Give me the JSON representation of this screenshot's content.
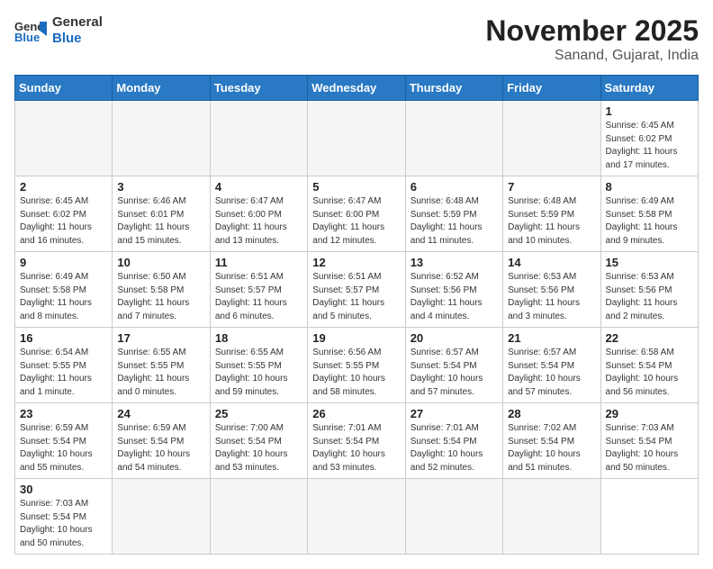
{
  "header": {
    "logo_general": "General",
    "logo_blue": "Blue",
    "month_year": "November 2025",
    "location": "Sanand, Gujarat, India"
  },
  "weekdays": [
    "Sunday",
    "Monday",
    "Tuesday",
    "Wednesday",
    "Thursday",
    "Friday",
    "Saturday"
  ],
  "days": [
    {
      "num": "",
      "info": ""
    },
    {
      "num": "",
      "info": ""
    },
    {
      "num": "",
      "info": ""
    },
    {
      "num": "",
      "info": ""
    },
    {
      "num": "",
      "info": ""
    },
    {
      "num": "",
      "info": ""
    },
    {
      "num": "1",
      "info": "Sunrise: 6:45 AM\nSunset: 6:02 PM\nDaylight: 11 hours\nand 17 minutes."
    },
    {
      "num": "2",
      "info": "Sunrise: 6:45 AM\nSunset: 6:02 PM\nDaylight: 11 hours\nand 16 minutes."
    },
    {
      "num": "3",
      "info": "Sunrise: 6:46 AM\nSunset: 6:01 PM\nDaylight: 11 hours\nand 15 minutes."
    },
    {
      "num": "4",
      "info": "Sunrise: 6:47 AM\nSunset: 6:00 PM\nDaylight: 11 hours\nand 13 minutes."
    },
    {
      "num": "5",
      "info": "Sunrise: 6:47 AM\nSunset: 6:00 PM\nDaylight: 11 hours\nand 12 minutes."
    },
    {
      "num": "6",
      "info": "Sunrise: 6:48 AM\nSunset: 5:59 PM\nDaylight: 11 hours\nand 11 minutes."
    },
    {
      "num": "7",
      "info": "Sunrise: 6:48 AM\nSunset: 5:59 PM\nDaylight: 11 hours\nand 10 minutes."
    },
    {
      "num": "8",
      "info": "Sunrise: 6:49 AM\nSunset: 5:58 PM\nDaylight: 11 hours\nand 9 minutes."
    },
    {
      "num": "9",
      "info": "Sunrise: 6:49 AM\nSunset: 5:58 PM\nDaylight: 11 hours\nand 8 minutes."
    },
    {
      "num": "10",
      "info": "Sunrise: 6:50 AM\nSunset: 5:58 PM\nDaylight: 11 hours\nand 7 minutes."
    },
    {
      "num": "11",
      "info": "Sunrise: 6:51 AM\nSunset: 5:57 PM\nDaylight: 11 hours\nand 6 minutes."
    },
    {
      "num": "12",
      "info": "Sunrise: 6:51 AM\nSunset: 5:57 PM\nDaylight: 11 hours\nand 5 minutes."
    },
    {
      "num": "13",
      "info": "Sunrise: 6:52 AM\nSunset: 5:56 PM\nDaylight: 11 hours\nand 4 minutes."
    },
    {
      "num": "14",
      "info": "Sunrise: 6:53 AM\nSunset: 5:56 PM\nDaylight: 11 hours\nand 3 minutes."
    },
    {
      "num": "15",
      "info": "Sunrise: 6:53 AM\nSunset: 5:56 PM\nDaylight: 11 hours\nand 2 minutes."
    },
    {
      "num": "16",
      "info": "Sunrise: 6:54 AM\nSunset: 5:55 PM\nDaylight: 11 hours\nand 1 minute."
    },
    {
      "num": "17",
      "info": "Sunrise: 6:55 AM\nSunset: 5:55 PM\nDaylight: 11 hours\nand 0 minutes."
    },
    {
      "num": "18",
      "info": "Sunrise: 6:55 AM\nSunset: 5:55 PM\nDaylight: 10 hours\nand 59 minutes."
    },
    {
      "num": "19",
      "info": "Sunrise: 6:56 AM\nSunset: 5:55 PM\nDaylight: 10 hours\nand 58 minutes."
    },
    {
      "num": "20",
      "info": "Sunrise: 6:57 AM\nSunset: 5:54 PM\nDaylight: 10 hours\nand 57 minutes."
    },
    {
      "num": "21",
      "info": "Sunrise: 6:57 AM\nSunset: 5:54 PM\nDaylight: 10 hours\nand 57 minutes."
    },
    {
      "num": "22",
      "info": "Sunrise: 6:58 AM\nSunset: 5:54 PM\nDaylight: 10 hours\nand 56 minutes."
    },
    {
      "num": "23",
      "info": "Sunrise: 6:59 AM\nSunset: 5:54 PM\nDaylight: 10 hours\nand 55 minutes."
    },
    {
      "num": "24",
      "info": "Sunrise: 6:59 AM\nSunset: 5:54 PM\nDaylight: 10 hours\nand 54 minutes."
    },
    {
      "num": "25",
      "info": "Sunrise: 7:00 AM\nSunset: 5:54 PM\nDaylight: 10 hours\nand 53 minutes."
    },
    {
      "num": "26",
      "info": "Sunrise: 7:01 AM\nSunset: 5:54 PM\nDaylight: 10 hours\nand 53 minutes."
    },
    {
      "num": "27",
      "info": "Sunrise: 7:01 AM\nSunset: 5:54 PM\nDaylight: 10 hours\nand 52 minutes."
    },
    {
      "num": "28",
      "info": "Sunrise: 7:02 AM\nSunset: 5:54 PM\nDaylight: 10 hours\nand 51 minutes."
    },
    {
      "num": "29",
      "info": "Sunrise: 7:03 AM\nSunset: 5:54 PM\nDaylight: 10 hours\nand 50 minutes."
    },
    {
      "num": "30",
      "info": "Sunrise: 7:03 AM\nSunset: 5:54 PM\nDaylight: 10 hours\nand 50 minutes."
    },
    {
      "num": "",
      "info": ""
    },
    {
      "num": "",
      "info": ""
    },
    {
      "num": "",
      "info": ""
    },
    {
      "num": "",
      "info": ""
    },
    {
      "num": "",
      "info": ""
    }
  ]
}
